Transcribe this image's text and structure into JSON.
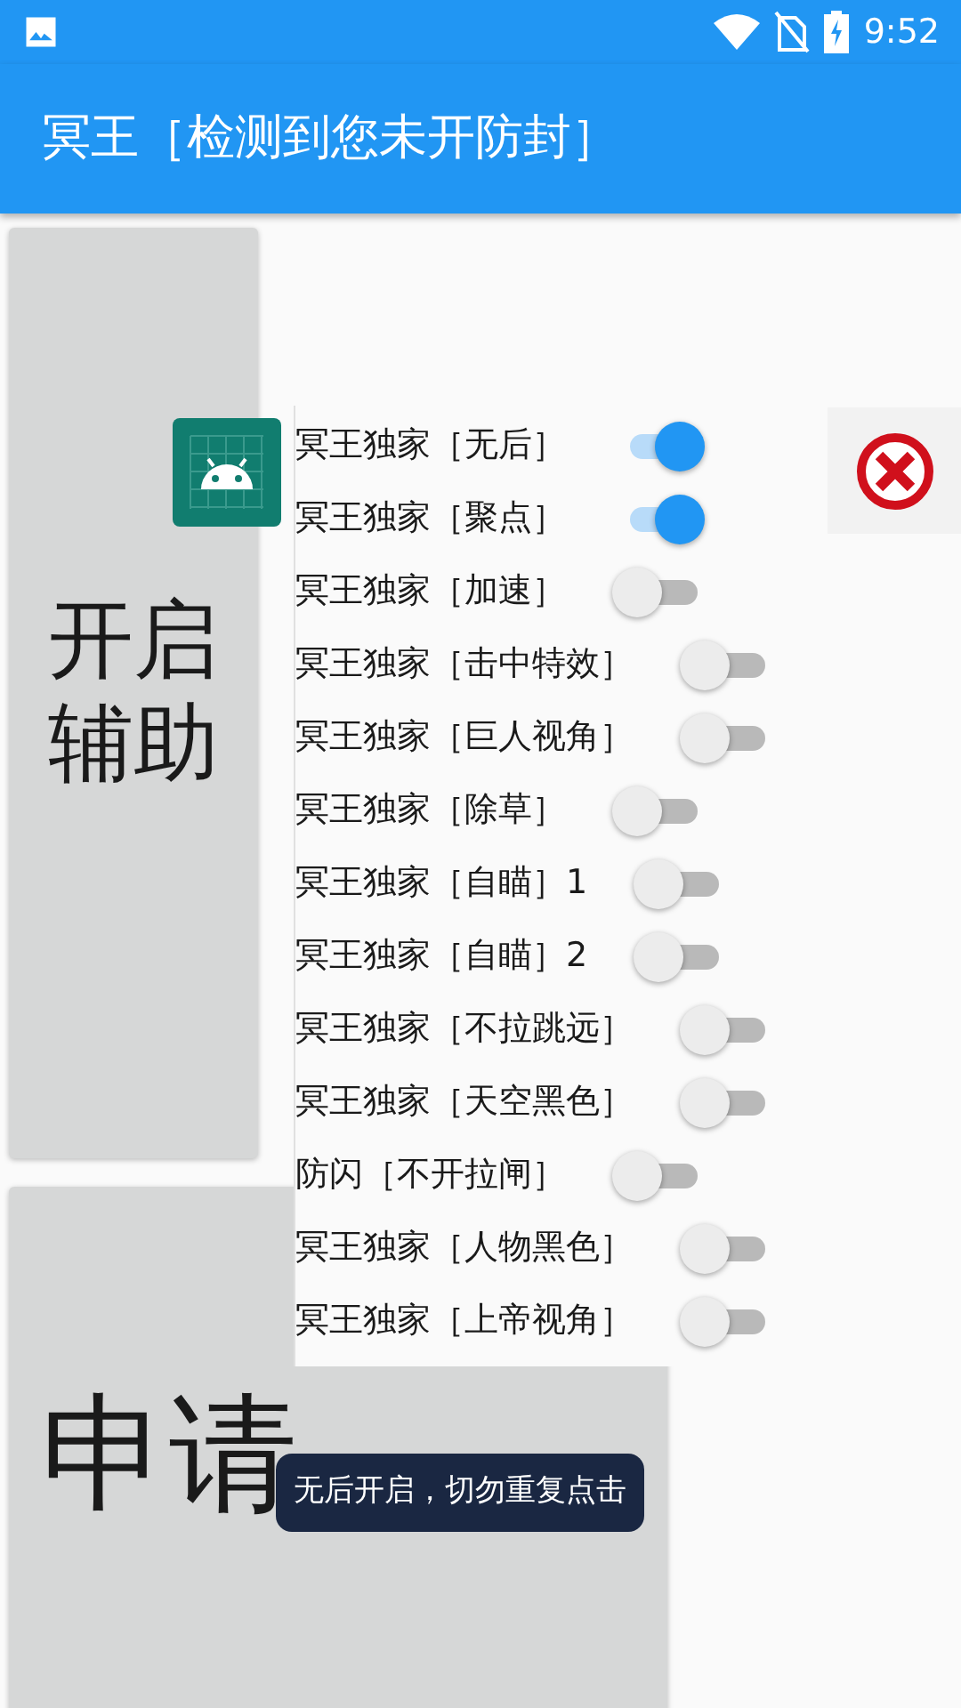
{
  "status_bar": {
    "time": "9:52"
  },
  "app_bar": {
    "title": "冥王［检测到您未开防封］"
  },
  "buttons": [
    {
      "label_lines": [
        "开启",
        "辅助"
      ]
    },
    {
      "label": "申请"
    }
  ],
  "menu": {
    "items": [
      {
        "label": "冥王独家［无后］",
        "on": true
      },
      {
        "label": "冥王独家［聚点］",
        "on": true
      },
      {
        "label": "冥王独家［加速］",
        "on": false
      },
      {
        "label": "冥王独家［击中特效］",
        "on": false
      },
      {
        "label": "冥王独家［巨人视角］",
        "on": false
      },
      {
        "label": "冥王独家［除草］",
        "on": false
      },
      {
        "label": "冥王独家［自瞄］1",
        "on": false
      },
      {
        "label": "冥王独家［自瞄］2",
        "on": false
      },
      {
        "label": "冥王独家［不拉跳远］",
        "on": false
      },
      {
        "label": "冥王独家［天空黑色］",
        "on": false
      },
      {
        "label": "防闪［不开拉闸］",
        "on": false
      },
      {
        "label": "冥王独家［人物黑色］",
        "on": false
      },
      {
        "label": "冥王独家［上帝视角］",
        "on": false
      }
    ]
  },
  "toast": {
    "text": "无后开启，切勿重复点击"
  }
}
